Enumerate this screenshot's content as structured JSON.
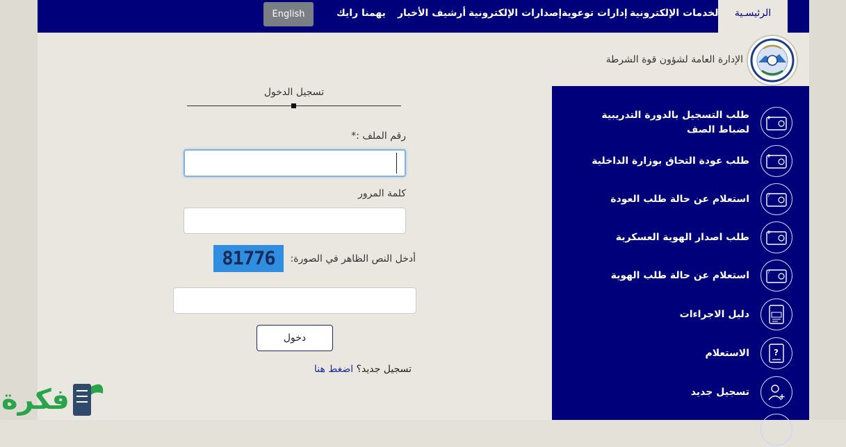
{
  "nav": {
    "home": "الرئيسـية",
    "items": [
      "الخدمات الإلكترونية",
      "إدارات توعوية",
      "إصدارات الإلكترونية",
      "أرشيف الأخبار",
      "يهمنا رايك"
    ],
    "lang": "English"
  },
  "header": {
    "dept": "الإدارة العامة لشؤون قوة الشرطة"
  },
  "login": {
    "title": "تسجيل الدخول",
    "file_label": "رقم الملف :*",
    "password_label": "كلمة المرور",
    "captcha_label": "أدخل النص الظاهر في الصورة:",
    "captcha_text": "81776",
    "submit": "دخول",
    "register_question": "تسجيل جديد؟",
    "register_link": "اضغط هنا"
  },
  "sidebar": {
    "items": [
      {
        "label": "طلب التسجيل بالدورة التدريبية لضباط الصف",
        "icon": "card-add-icon"
      },
      {
        "label": "طلب عودة التحاق بوزارة الداخلية",
        "icon": "card-add-icon"
      },
      {
        "label": "استعلام عن حالة طلب العودة",
        "icon": "card-query-icon"
      },
      {
        "label": "طلب اصدار الهوية العسكرية",
        "icon": "card-add-icon"
      },
      {
        "label": "استعلام عن حالة طلب الهوية",
        "icon": "card-query-icon"
      },
      {
        "label": "دليل الاجراءات",
        "icon": "pdf-icon"
      },
      {
        "label": "الاستعلام",
        "icon": "question-doc-icon"
      },
      {
        "label": "تسجيل جديد",
        "icon": "user-add-icon"
      }
    ]
  },
  "watermark": "فكرة",
  "colors": {
    "navy": "#00007a",
    "captcha_bg": "#2f8ee0",
    "watermark_green": "#2aa44a"
  }
}
